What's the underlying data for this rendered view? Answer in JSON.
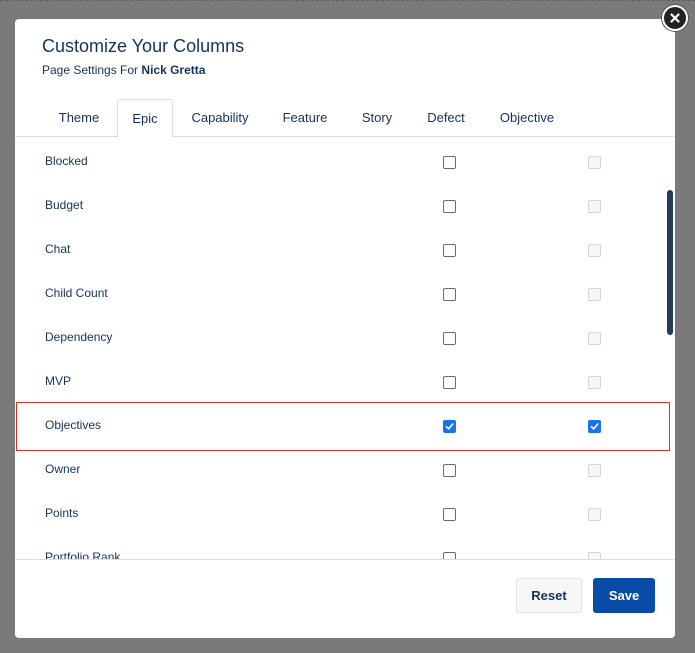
{
  "dialog": {
    "title": "Customize Your Columns",
    "subtitle_prefix": "Page Settings For",
    "user_name": "Nick Gretta"
  },
  "tabs": [
    {
      "label": "Theme",
      "active": false
    },
    {
      "label": "Epic",
      "active": true
    },
    {
      "label": "Capability",
      "active": false
    },
    {
      "label": "Feature",
      "active": false
    },
    {
      "label": "Story",
      "active": false
    },
    {
      "label": "Defect",
      "active": false
    },
    {
      "label": "Objective",
      "active": false
    }
  ],
  "rows": [
    {
      "label": "Blocked",
      "col1_checked": false,
      "col2_checked": false
    },
    {
      "label": "Budget",
      "col1_checked": false,
      "col2_checked": false
    },
    {
      "label": "Chat",
      "col1_checked": false,
      "col2_checked": false
    },
    {
      "label": "Child Count",
      "col1_checked": false,
      "col2_checked": false
    },
    {
      "label": "Dependency",
      "col1_checked": false,
      "col2_checked": false
    },
    {
      "label": "MVP",
      "col1_checked": false,
      "col2_checked": false
    },
    {
      "label": "Objectives",
      "col1_checked": true,
      "col2_checked": true
    },
    {
      "label": "Owner",
      "col1_checked": false,
      "col2_checked": false
    },
    {
      "label": "Points",
      "col1_checked": false,
      "col2_checked": false
    },
    {
      "label": "Portfolio Rank",
      "col1_checked": false,
      "col2_checked": false
    }
  ],
  "footer": {
    "reset_label": "Reset",
    "save_label": "Save"
  },
  "colors": {
    "accent": "#0b4ba8",
    "checkbox_checked": "#1a73e8",
    "highlight": "#d93025",
    "text": "#16325c"
  }
}
